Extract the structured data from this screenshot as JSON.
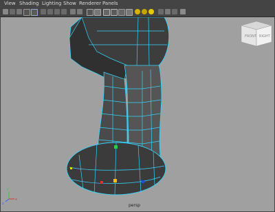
{
  "menu": {
    "view": "View",
    "shading": "Shading",
    "lighting": "Lighting",
    "show": "Show",
    "renderer": "Renderer",
    "panels": "Panels"
  },
  "viewcube": {
    "front": "FRONT",
    "right": "RIGHT"
  },
  "axes": {
    "x": "x",
    "y": "y",
    "z": "z"
  },
  "viewport": {
    "camera_label": "persp"
  },
  "colors": {
    "viewport_bg": "#a0a0a0",
    "mesh_fill": "#3b3b3b",
    "wire": "#33d6ff"
  }
}
